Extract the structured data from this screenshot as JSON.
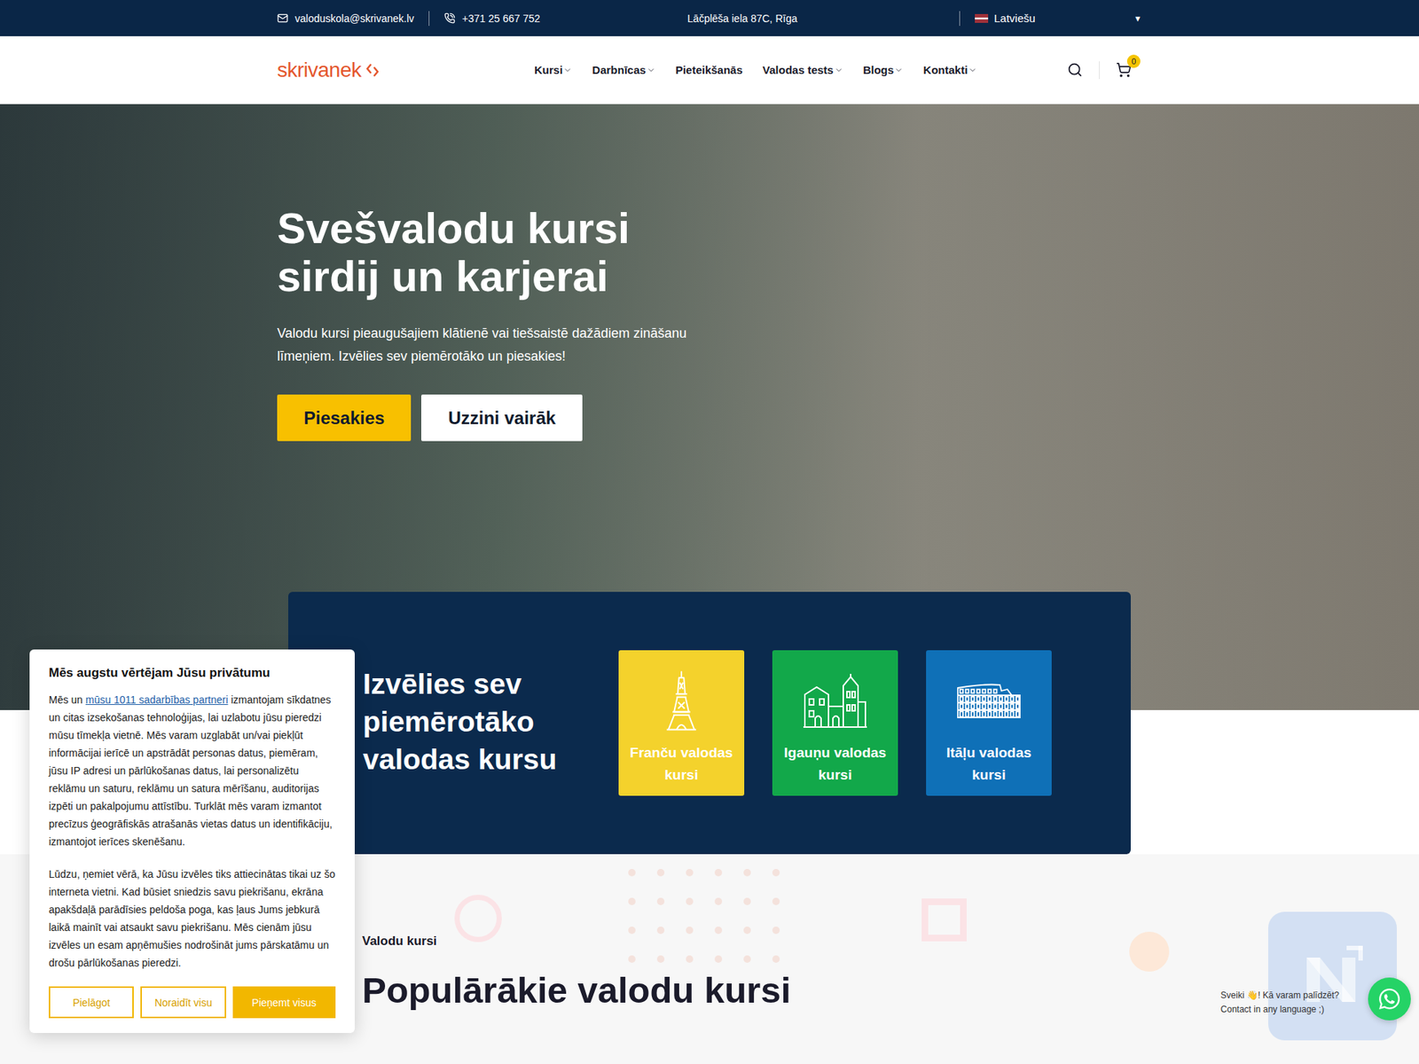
{
  "top_bar": {
    "email": "valoduskola@skrivanek.lv",
    "phone": "+371 25 667 752",
    "address": "Lāčplēša iela 87C, Rīga",
    "language": {
      "label": "Latviešu",
      "arrow": "▼"
    }
  },
  "header": {
    "logo": "skrivanek",
    "nav": [
      {
        "label": "Kursi",
        "has_dropdown": true
      },
      {
        "label": "Darbnīcas",
        "has_dropdown": true
      },
      {
        "label": "Pieteikšanās",
        "has_dropdown": false
      },
      {
        "label": "Valodas tests",
        "has_dropdown": true
      },
      {
        "label": "Blogs",
        "has_dropdown": true
      },
      {
        "label": "Kontakti",
        "has_dropdown": true
      }
    ],
    "cart_count": "0"
  },
  "hero": {
    "title_lines": [
      "Svešvalodu kursi",
      "sirdij un karjerai"
    ],
    "subtitle_lines": [
      "Valodu kursi pieaugušajiem klātienē vai tiešsaistē dažādiem zināšanu",
      "līmeņiem. Izvēlies sev piemērotāko un piesakies!"
    ],
    "buttons": [
      {
        "label": "Piesakies",
        "kind": "primary"
      },
      {
        "label": "Uzzini vairāk",
        "kind": "secondary"
      }
    ]
  },
  "course_picker": {
    "title": "Izvēlies sev piemērotāko valodas kursu",
    "tiles": [
      {
        "label": "Franču valodas kursi",
        "color": "#f4d22c"
      },
      {
        "label": "Igauņu valodas kursi",
        "color": "#12a84a"
      },
      {
        "label": "Itāļu valodas kursi",
        "color": "#0f70b7"
      }
    ]
  },
  "popular": {
    "eyebrow": "Valodu kursi",
    "heading": "Populārākie valodu kursi"
  },
  "cookie_banner": {
    "title": "Mēs augstu vērtējam Jūsu privātumu",
    "paragraph1_before": "Mēs un ",
    "paragraph1_link": "mūsu 1011 sadarbības partneri",
    "paragraph1_after": " izmantojam sīkdatnes un citas izsekošanas tehnoloģijas, lai uzlabotu jūsu pieredzi mūsu tīmekļa vietnē. Mēs varam uzglabāt un/vai piekļūt informācijai ierīcē un apstrādāt personas datus, piemēram, jūsu IP adresi un pārlūkošanas datus, lai personalizētu reklāmu un saturu, reklāmu un satura mērīšanu, auditorijas izpēti un pakalpojumu attīstību. Turklāt mēs varam izmantot precīzus ģeogrāfiskās atrašanās vietas datus un identifikāciju, izmantojot ierīces skenēšanu.",
    "paragraph2": "Lūdzu, ņemiet vērā, ka Jūsu izvēles tiks attiecinātas tikai uz šo interneta vietni. Kad būsiet sniedzis savu piekrišanu, ekrāna apakšdaļā parādīsies peldoša poga, kas ļaus Jums jebkurā laikā mainīt vai atsaukt savu piekrišanu. Mēs cienām jūsu izvēles un esam apņēmušies nodrošināt jums pārskatāmu un drošu pārlūkošanas pieredzi.",
    "buttons": [
      {
        "label": "Pielāgot",
        "kind": "outline"
      },
      {
        "label": "Noraidīt visu",
        "kind": "outline"
      },
      {
        "label": "Pieņemt visus",
        "kind": "filled"
      }
    ]
  },
  "chat": {
    "greeting": "Sveiki 👋! Kā varam palīdzēt?",
    "subtext": "Contact in any language ;)"
  }
}
